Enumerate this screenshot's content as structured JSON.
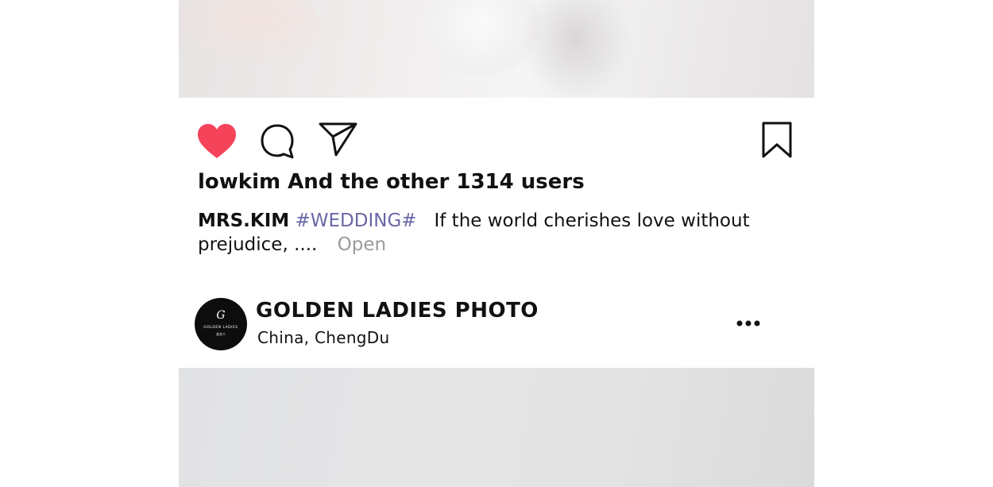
{
  "post": {
    "likes_text": "lowkim And the other 1314 users",
    "caption": {
      "username": "MRS.KIM",
      "hashtag": "#WEDDING#",
      "text_line1": "If the world cherishes love without",
      "text_line2": "prejudice, ....",
      "open_label": "Open"
    },
    "actions": {
      "like_color": "#f5435a",
      "icons": [
        "heart-icon",
        "comment-icon",
        "share-icon",
        "bookmark-icon"
      ]
    }
  },
  "next_post": {
    "account_name": "GOLDEN LADIES PHOTO",
    "location_country": "China,",
    "location_city": "ChengDu",
    "avatar": {
      "monogram": "G",
      "brand": "GOLDEN LADIES",
      "brand_sub": "金夫人"
    },
    "more_icon": "more-dots-icon"
  }
}
